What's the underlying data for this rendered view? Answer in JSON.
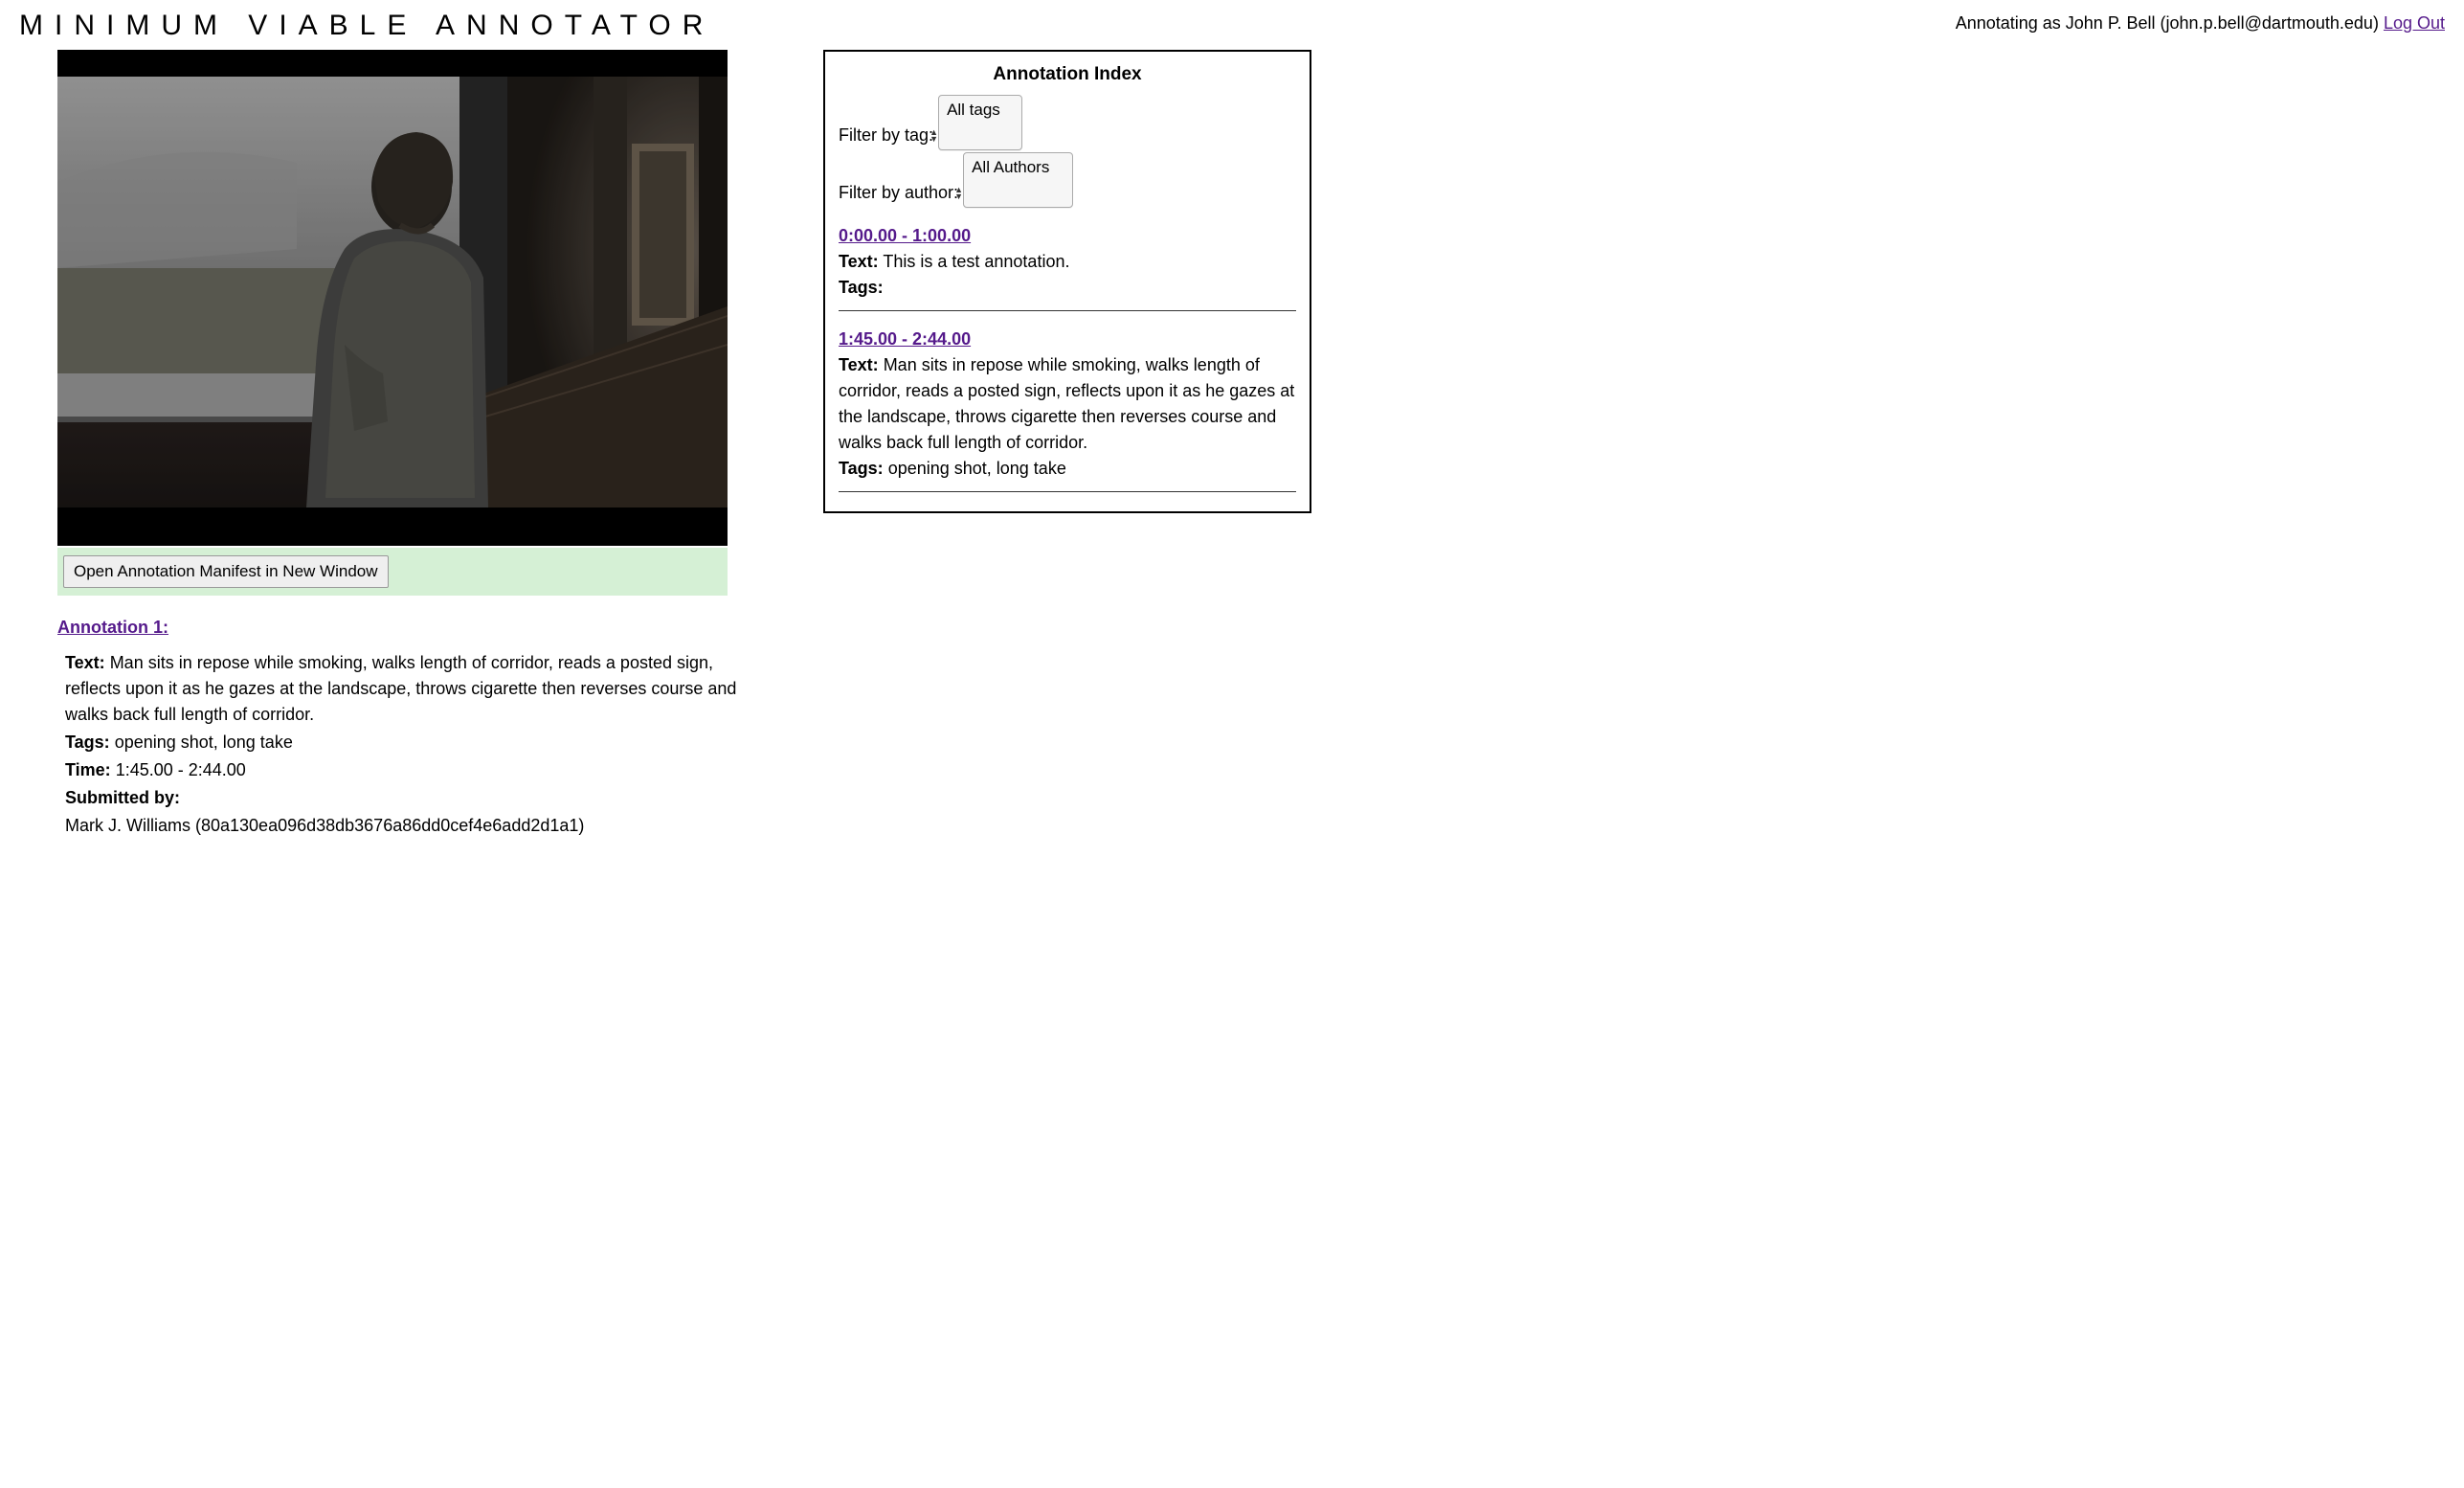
{
  "header": {
    "app_title": "MINIMUM VIABLE ANNOTATOR",
    "user_prefix": "Annotating as ",
    "user_name": "John P. Bell",
    "user_email": "john.p.bell@dartmouth.edu",
    "logout_label": "Log Out"
  },
  "manifest": {
    "button_label": "Open Annotation Manifest in New Window"
  },
  "detail": {
    "title": "Annotation 1:",
    "text_label": "Text:",
    "text_value": "Man sits in repose while smoking, walks length of corridor, reads a posted sign, reflects upon it as he gazes at the landscape, throws cigarette then reverses course and walks back full length of corridor.",
    "tags_label": "Tags:",
    "tags_value": "opening shot, long take",
    "time_label": "Time:",
    "time_value": "1:45.00 - 2:44.00",
    "submitted_by_label": "Submitted by:",
    "submitted_by_value": "Mark J. Williams (80a130ea096d38db3676a86dd0cef4e6add2d1a1)"
  },
  "index": {
    "title": "Annotation Index",
    "filter_tag_label": "Filter by tag:",
    "filter_tag_selected": "All tags",
    "filter_author_label": "Filter by author:",
    "filter_author_selected": "All Authors",
    "items": [
      {
        "time_range": "0:00.00 - 1:00.00",
        "text_label": "Text:",
        "text_value": "This is a test annotation.",
        "tags_label": "Tags:",
        "tags_value": ""
      },
      {
        "time_range": "1:45.00 - 2:44.00",
        "text_label": "Text:",
        "text_value": "Man sits in repose while smoking, walks length of corridor, reads a posted sign, reflects upon it as he gazes at the landscape, throws cigarette then reverses course and walks back full length of corridor.",
        "tags_label": "Tags:",
        "tags_value": "opening shot, long take"
      }
    ]
  }
}
